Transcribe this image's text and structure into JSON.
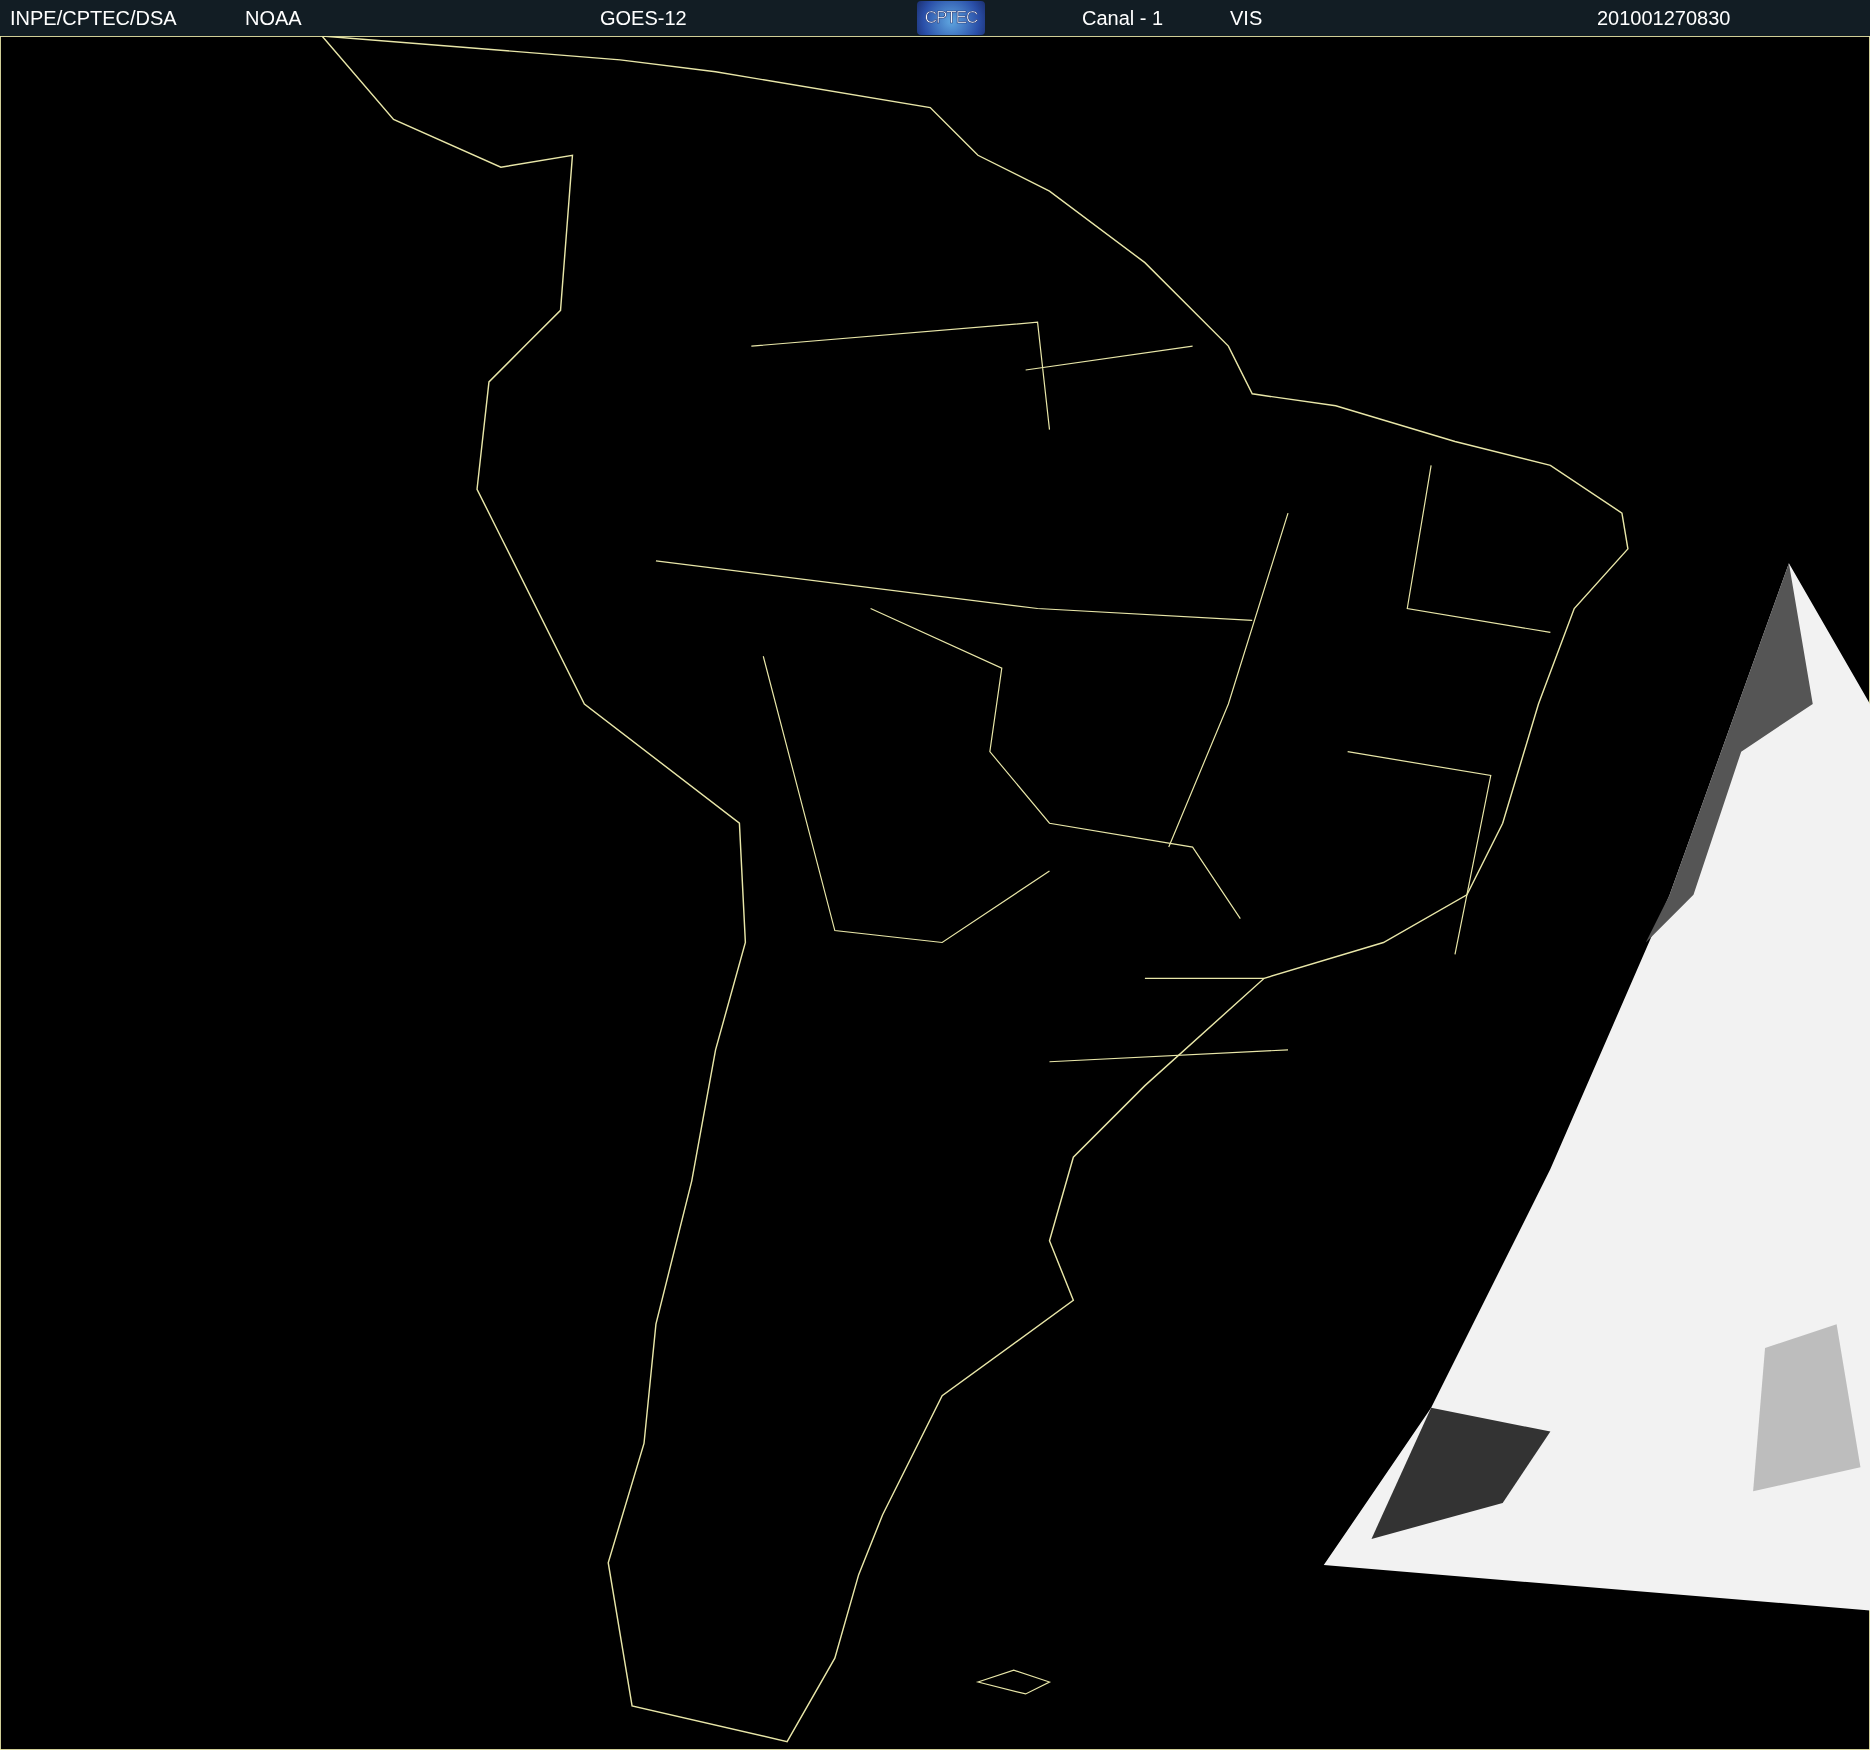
{
  "header": {
    "items": [
      {
        "kind": "text",
        "text": "INPE/CPTEC/DSA"
      },
      {
        "kind": "text",
        "text": "NOAA"
      },
      {
        "kind": "text",
        "text": "GOES-12"
      },
      {
        "kind": "logo",
        "text": "CPTEC"
      },
      {
        "kind": "text",
        "text": "Canal - 1"
      },
      {
        "kind": "text",
        "text": "VIS"
      },
      {
        "kind": "text",
        "text": "201001270830"
      }
    ]
  }
}
